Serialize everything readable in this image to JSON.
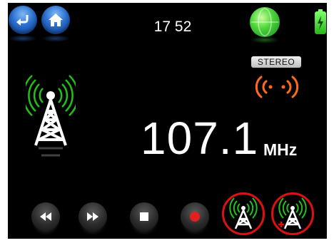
{
  "status_bar": {
    "clock": "17 52",
    "icons": [
      "back-icon",
      "home-icon",
      "globe-icon",
      "battery-icon"
    ]
  },
  "radio": {
    "stereo_label": "STEREO",
    "frequency": "107.1",
    "unit": "MHz"
  },
  "controls": [
    "rewind-icon",
    "fast-forward-icon",
    "stop-icon",
    "record-icon"
  ],
  "presets": [
    "preset-1",
    "preset-2"
  ],
  "colors": {
    "background": "#000000",
    "signal_green": "#22c11a",
    "stereo_orange": "#ff6a1a",
    "preset_ring": "#e01010"
  }
}
